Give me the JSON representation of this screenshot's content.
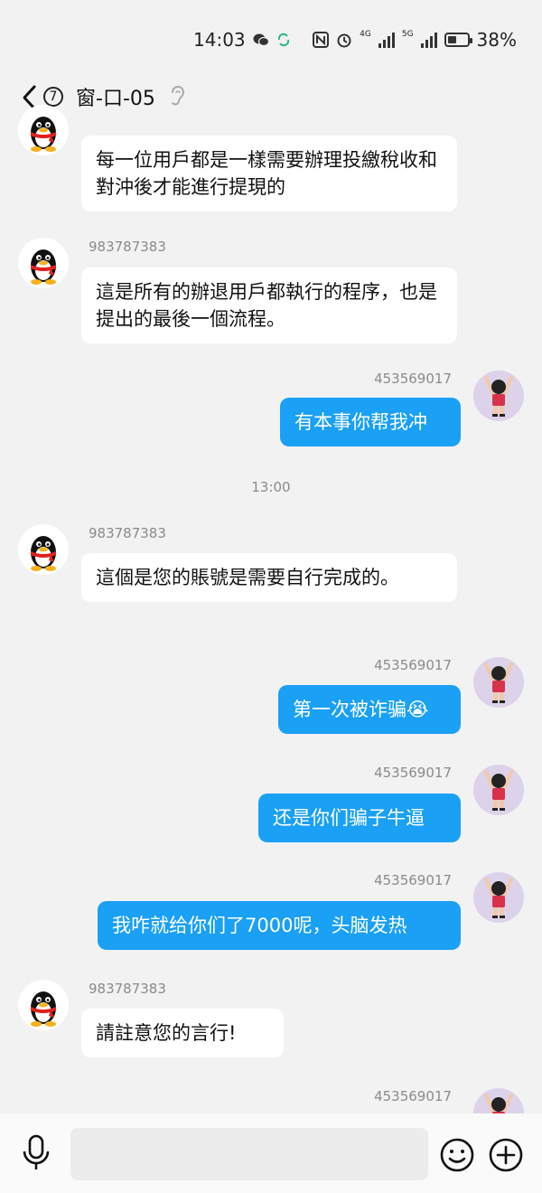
{
  "status_bar": {
    "time": "14:03",
    "battery": "38%",
    "network_1": "4G",
    "network_2": "5G"
  },
  "header": {
    "unread_count": "7",
    "title": "窗-口-05"
  },
  "timestamp": "13:00",
  "messages": [
    {
      "side": "in",
      "sender": "",
      "text": "每一位用戶都是一樣需要辦理投繳稅收和對沖後才能進行提現的"
    },
    {
      "side": "in",
      "sender": "983787383",
      "text": "這是所有的辦退用戶都執行的程序，也是提出的最後一個流程。"
    },
    {
      "side": "out",
      "sender": "453569017",
      "text": "有本事你帮我冲"
    },
    {
      "side": "in",
      "sender": "983787383",
      "text": "這個是您的賬號是需要自行完成的。"
    },
    {
      "side": "out",
      "sender": "453569017",
      "text": "第一次被诈骗",
      "emoji": "😭"
    },
    {
      "side": "out",
      "sender": "453569017",
      "text": "还是你们骗子牛逼"
    },
    {
      "side": "out",
      "sender": "453569017",
      "text": "我咋就给你们了7000呢，头脑发热"
    },
    {
      "side": "in",
      "sender": "983787383",
      "text": "請註意您的言行!"
    },
    {
      "side": "out",
      "sender": "453569017",
      "text": ""
    }
  ],
  "input": {
    "placeholder": ""
  },
  "colors": {
    "out_bubble": "#1aa0f5",
    "in_bubble": "#ffffff",
    "background": "#f2f2f2"
  }
}
